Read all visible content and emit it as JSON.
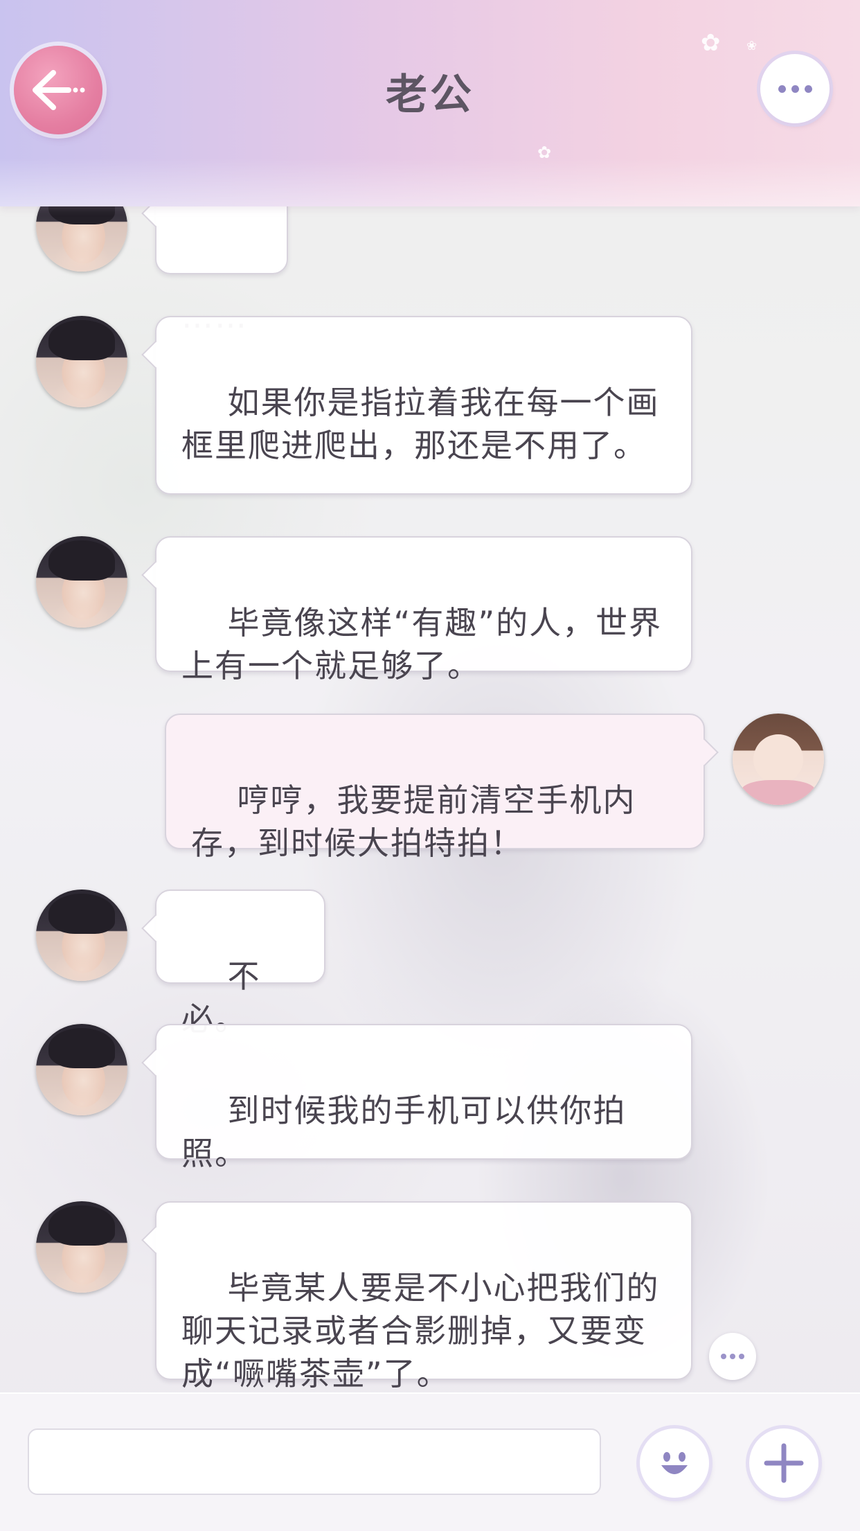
{
  "header": {
    "title": "老公",
    "back_icon": "back-arrow-icon",
    "more_icon": "more-dots-icon"
  },
  "messages": [
    {
      "side": "left",
      "text": "……"
    },
    {
      "side": "left",
      "text": "如果你是指拉着我在每一个画框里爬进爬出，那还是不用了。"
    },
    {
      "side": "left",
      "text": "毕竟像这样“有趣”的人，世界上有一个就足够了。"
    },
    {
      "side": "right",
      "text": "哼哼，我要提前清空手机内存，到时候大拍特拍！"
    },
    {
      "side": "left",
      "text": "不必。"
    },
    {
      "side": "left",
      "text": "到时候我的手机可以供你拍照。"
    },
    {
      "side": "left",
      "text": "毕竟某人要是不小心把我们的聊天记录或者合影删掉，又要变成“噘嘴茶壶”了。"
    }
  ],
  "input": {
    "value": "",
    "emoji_icon": "smiley-icon",
    "add_icon": "plus-icon"
  },
  "colors": {
    "header_start": "#c9c3ef",
    "header_end": "#f6dbe6",
    "accent_pink": "#e57fa2",
    "accent_purple": "#8f86c2"
  }
}
